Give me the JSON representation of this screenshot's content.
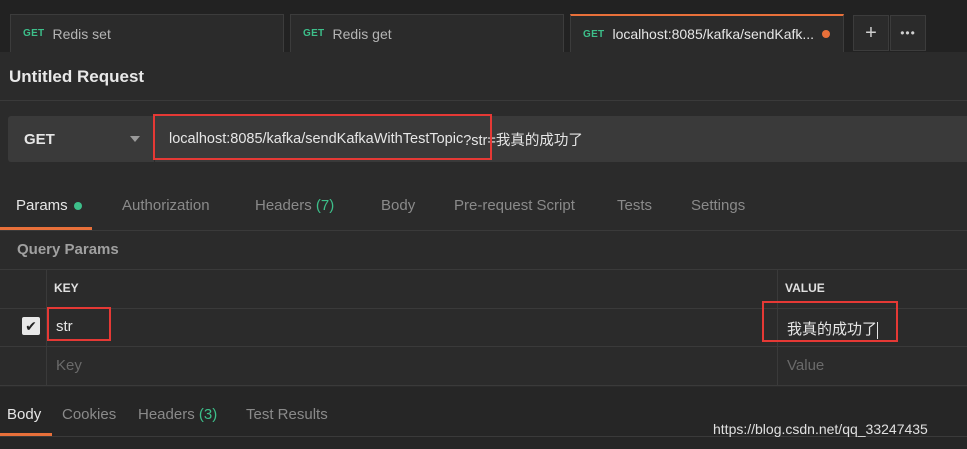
{
  "tabs": [
    {
      "method": "GET",
      "title": "Redis set"
    },
    {
      "method": "GET",
      "title": "Redis get"
    },
    {
      "method": "GET",
      "title": "localhost:8085/kafka/sendKafk..."
    }
  ],
  "tab_actions": {
    "add_icon": "+",
    "more_icon": "•••"
  },
  "request": {
    "title": "Untitled Request",
    "method": "GET",
    "url_base": "localhost:8085/kafka/sendKafkaWithTestTopic",
    "url_query": "?str=我真的成功了"
  },
  "request_tabs": {
    "params": "Params",
    "authorization": "Authorization",
    "headers": "Headers",
    "headers_count": "(7)",
    "body": "Body",
    "prerequest": "Pre-request Script",
    "tests": "Tests",
    "settings": "Settings"
  },
  "query_params": {
    "title": "Query Params",
    "key_header": "KEY",
    "value_header": "VALUE",
    "rows": [
      {
        "key": "str",
        "value": "我真的成功了",
        "checked": true
      }
    ],
    "key_placeholder": "Key",
    "value_placeholder": "Value"
  },
  "response_tabs": {
    "body": "Body",
    "cookies": "Cookies",
    "headers": "Headers",
    "headers_count": "(3)",
    "test_results": "Test Results"
  },
  "watermark": "https://blog.csdn.net/qq_33247435",
  "colors": {
    "accent": "#e8703a",
    "method_green": "#3dbf8a",
    "highlight_red": "#e53935"
  }
}
